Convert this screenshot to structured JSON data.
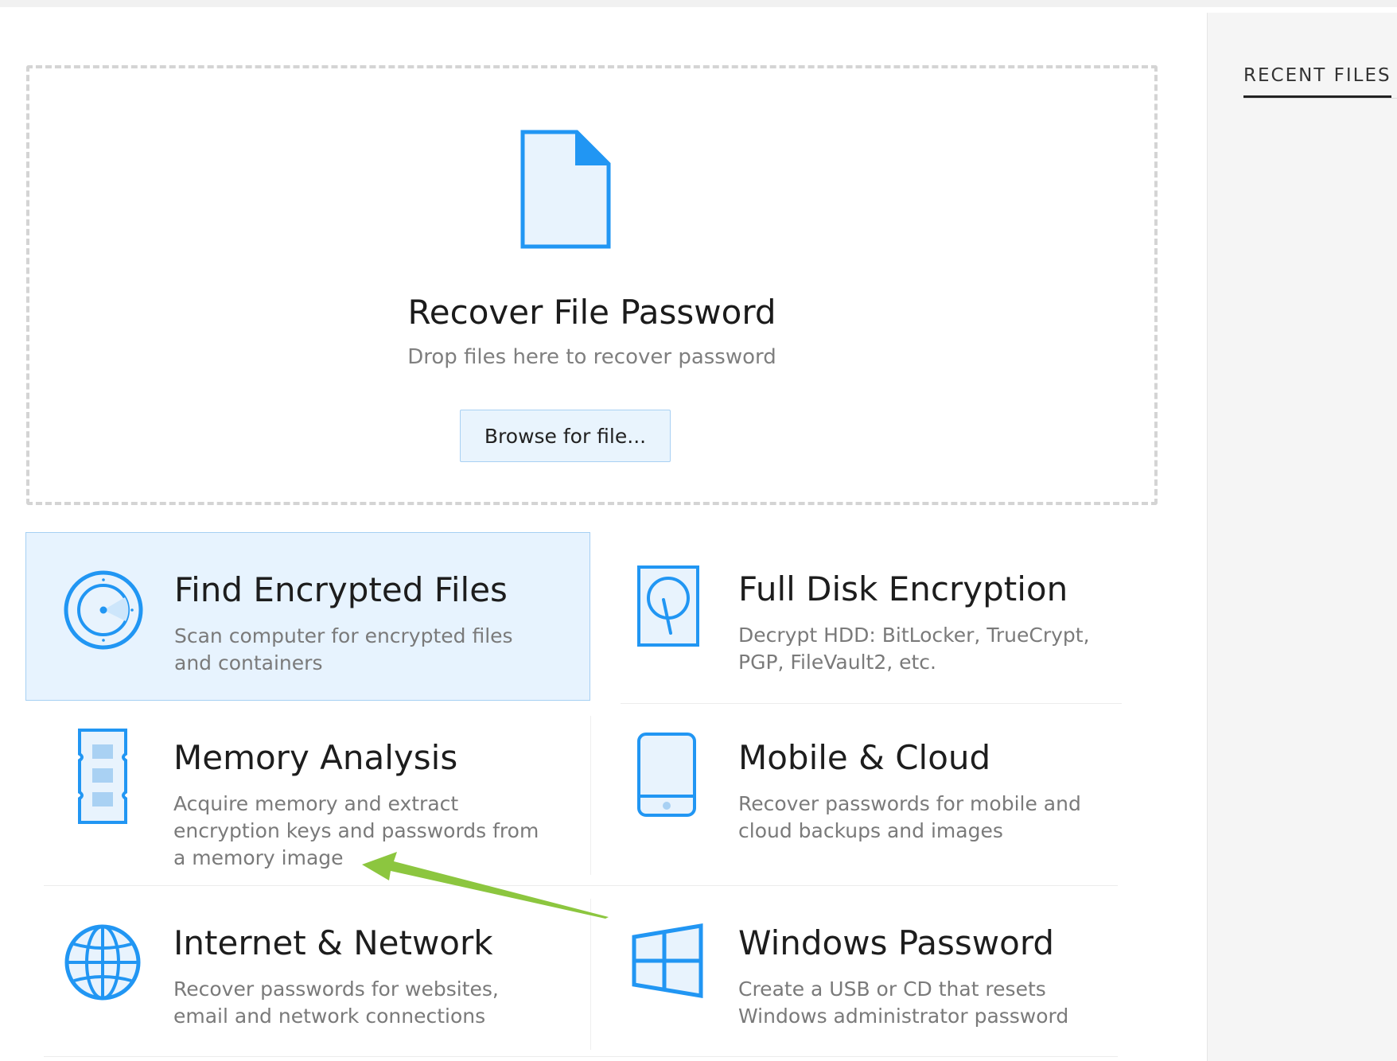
{
  "sidebar": {
    "tab_label": "RECENT FILES"
  },
  "dropzone": {
    "title": "Recover File Password",
    "subtitle": "Drop files here to recover password",
    "browse_label": "Browse for file..."
  },
  "tiles": [
    {
      "title": "Find Encrypted Files",
      "desc": "Scan computer for encrypted files and containers",
      "icon": "disc-scan-icon",
      "selected": true
    },
    {
      "title": "Full Disk Encryption",
      "desc": "Decrypt HDD: BitLocker, TrueCrypt, PGP, FileVault2, etc.",
      "icon": "hard-disk-icon",
      "selected": false
    },
    {
      "title": "Memory Analysis",
      "desc": "Acquire memory and extract encryption keys and passwords from a memory image",
      "icon": "memory-chip-icon",
      "selected": false
    },
    {
      "title": "Mobile & Cloud",
      "desc": "Recover passwords for mobile and cloud backups and images",
      "icon": "mobile-phone-icon",
      "selected": false
    },
    {
      "title": "Internet & Network",
      "desc": "Recover passwords for websites, email and network connections",
      "icon": "globe-icon",
      "selected": false
    },
    {
      "title": "Windows Password",
      "desc": "Create a USB or CD that resets Windows administrator password",
      "icon": "windows-logo-icon",
      "selected": false
    }
  ],
  "colors": {
    "accent": "#2196f3",
    "icon_fill": "#e8f3fd",
    "selected_bg": "#e7f3fe",
    "annotation_arrow": "#8cc63f"
  }
}
